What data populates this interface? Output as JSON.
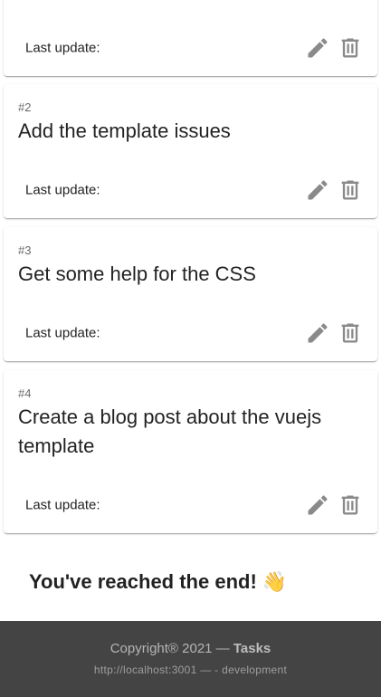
{
  "tasks": [
    {
      "number": "",
      "title": "",
      "last_update_label": "Last update:"
    },
    {
      "number": "#2",
      "title": "Add the template issues",
      "last_update_label": "Last update:"
    },
    {
      "number": "#3",
      "title": "Get some help for the CSS",
      "last_update_label": "Last update:"
    },
    {
      "number": "#4",
      "title": "Create a blog post about the vuejs template",
      "last_update_label": "Last update:"
    }
  ],
  "end_message": "You've reached the end! 👋",
  "footer": {
    "copyright": "Copyright® 2021 —",
    "app_name": "Tasks",
    "environment": "http://localhost:3001 — - development"
  },
  "icons": {
    "edit": "pencil-icon",
    "delete": "trash-icon"
  },
  "colors": {
    "icon": "#8a8a8a",
    "footer_bg": "#444444"
  }
}
